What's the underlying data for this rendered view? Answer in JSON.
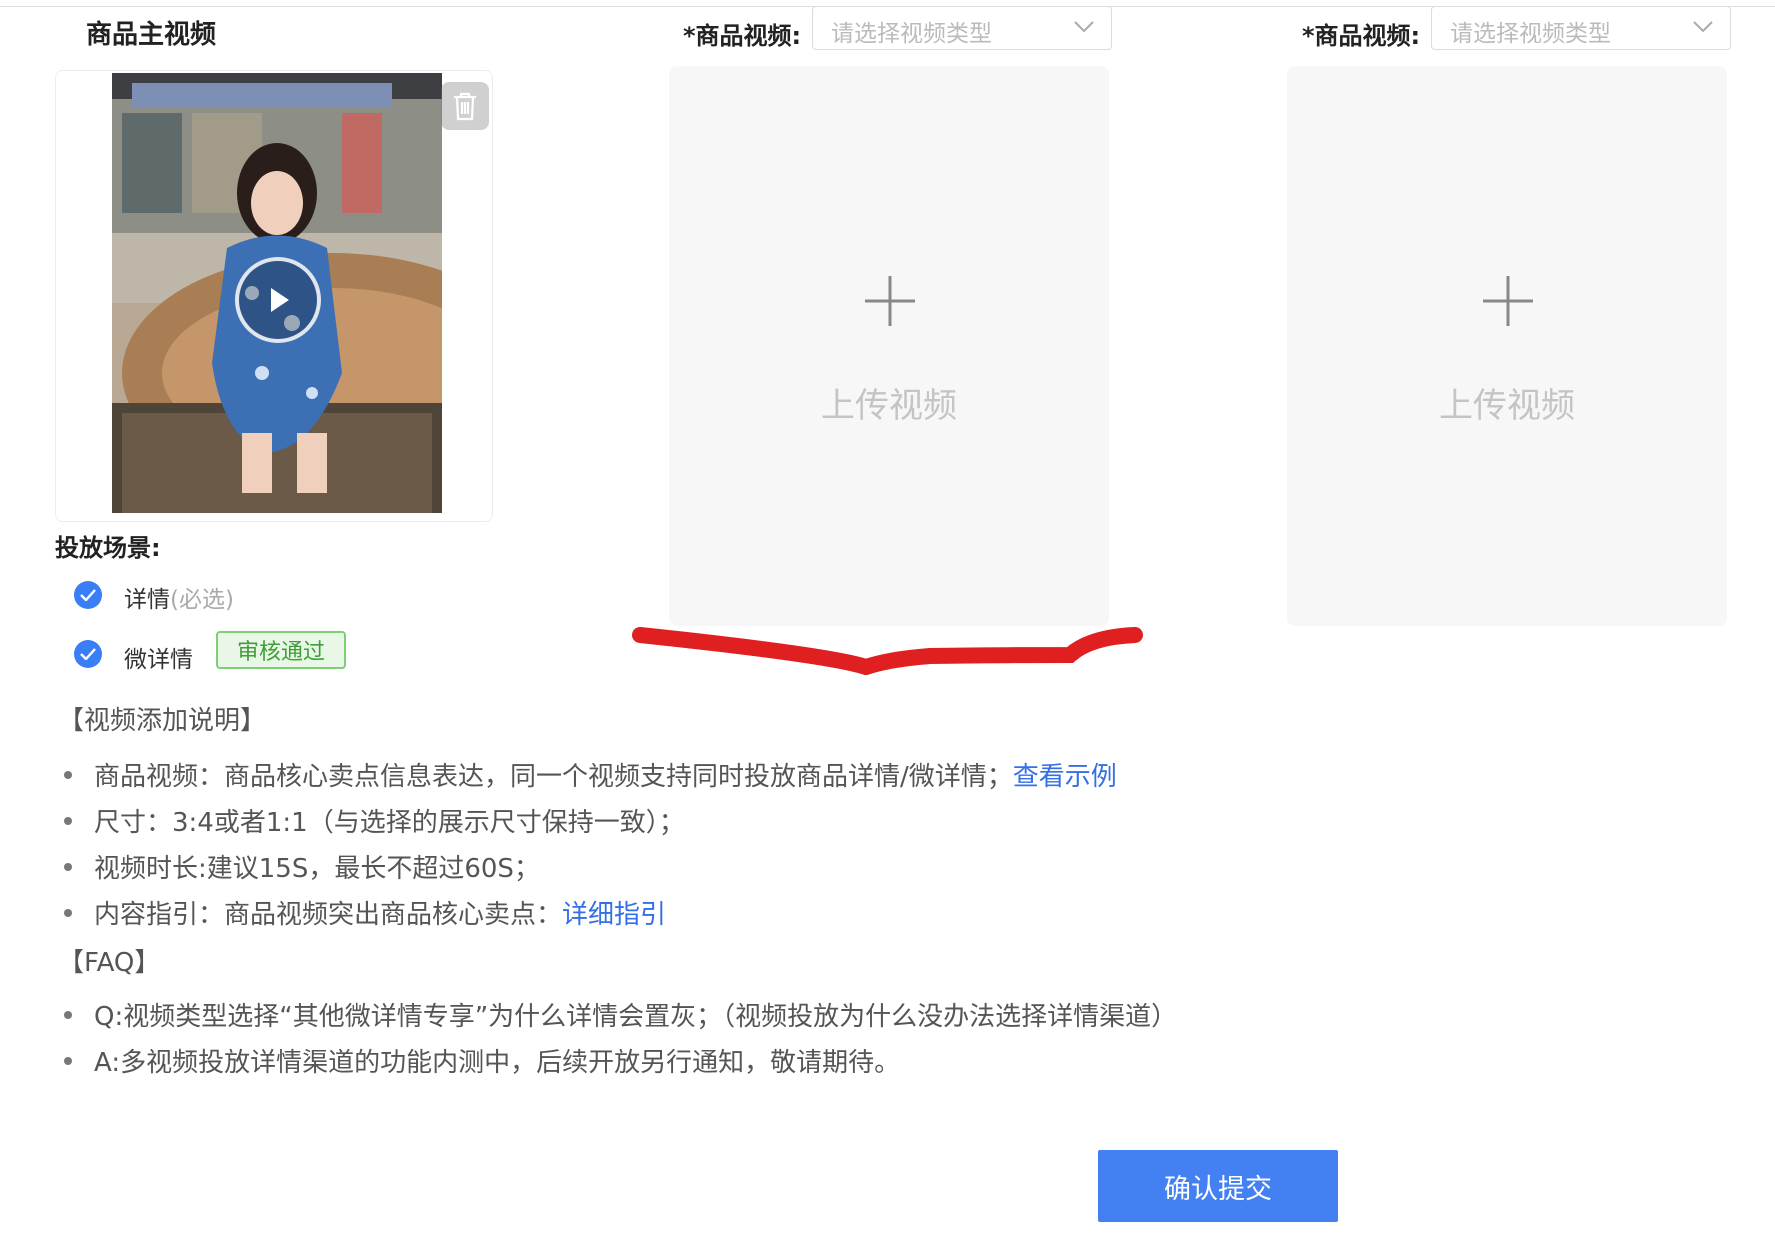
{
  "main_video": {
    "title": "商品主视频"
  },
  "video_slots": [
    {
      "label": "*商品视频:",
      "placeholder": "请选择视频类型",
      "upload_text": "上传视频"
    },
    {
      "label": "*商品视频:",
      "placeholder": "请选择视频类型",
      "upload_text": "上传视频"
    }
  ],
  "scenes": {
    "label": "投放场景:",
    "options": [
      {
        "label": "详情",
        "hint": "(必选)",
        "checked": true
      },
      {
        "label": "微详情",
        "badge": "审核通过",
        "checked": true
      }
    ]
  },
  "instructions": {
    "title": "【视频添加说明】",
    "items": [
      {
        "text": "商品视频：商品核心卖点信息表达，同一个视频支持同时投放商品详情/微详情；",
        "link": "查看示例"
      },
      {
        "text": "尺寸：3:4或者1:1（与选择的展示尺寸保持一致）；"
      },
      {
        "text": "视频时长:建议15S，最长不超过60S；"
      },
      {
        "text": "内容指引：商品视频突出商品核心卖点：",
        "link": "详细指引"
      }
    ]
  },
  "faq": {
    "title": "【FAQ】",
    "items": [
      "Q:视频类型选择“其他微详情专享”为什么详情会置灰；（视频投放为什么没办法选择详情渠道）",
      "A:多视频投放详情渠道的功能内测中，后续开放另行通知，敬请期待。"
    ]
  },
  "submit_label": "确认提交",
  "colors": {
    "primary": "#4381f3",
    "link": "#3370e8",
    "badge_green": "#3f9e37",
    "annotation_red": "#e02020"
  }
}
